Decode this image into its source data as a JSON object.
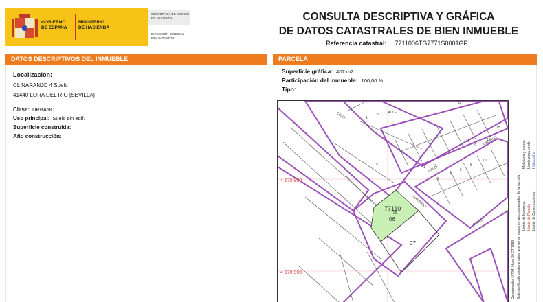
{
  "header": {
    "gov_line1": "GOBIERNO",
    "gov_line2": "DE ESPAÑA",
    "ministry_line1": "MINISTERIO",
    "ministry_line2": "DE HACIENDA",
    "secretaria_line1": "SECRETARÍA DE ESTADO",
    "secretaria_line2": "DE HACIENDA",
    "direccion_line1": "DIRECCIÓN GENERAL",
    "direccion_line2": "DEL CATASTRO",
    "title_line1": "CONSULTA DESCRIPTIVA Y GRÁFICA",
    "title_line2": "DE DATOS CATASTRALES DE BIEN INMUEBLE",
    "ref_label": "Referencia catastral:",
    "ref_value": "7711006TG7771S0001GP"
  },
  "colors": {
    "accent": "#ee7c1e",
    "logo_yellow": "#f7c316",
    "parcel_green": "#c8f0b4",
    "block_purple": "#9b4fb8",
    "coord_red": "#e05050"
  },
  "left": {
    "section_title_prefix": "DATOS DESCRIPTIVOS DEL ",
    "section_title_emph": "INMUEBLE",
    "loc_label": "Localización:",
    "address_line1": "CL NARANJO 4 Suelo",
    "address_line2": "41440 LORA DEL RIO [SEVILLA]",
    "clase_label": "Clase:",
    "clase_value": "URBANO",
    "uso_label": "Uso principal:",
    "uso_value": "Suelo sin edif.",
    "sup_label": "Superficie construida:",
    "ano_label": "Año construcción:"
  },
  "right": {
    "section_title": "PARCELA",
    "sup_label": "Superficie gráfica:",
    "sup_value": "407 m2",
    "part_label": "Participación del inmueble:",
    "part_value": "100,00 %",
    "tipo_label": "Tipo:"
  },
  "map": {
    "coord_y1": "4 170 950",
    "coord_y2": "4 170 900",
    "block_id": "77110",
    "parcel_selected": "06",
    "parcel_other": "07",
    "parcel_small_label": "06",
    "street_calle_1": "CALLE",
    "street_calle_2": "CALLE",
    "street_calle_3": "CALLE",
    "street_calle_4": "CALLE",
    "street_naranjo": "NARANJO",
    "street_ciruelo": "CIRUELO",
    "num_1": "1",
    "num_3": "3",
    "num_4": "4",
    "num_6": "6",
    "num_8": "8",
    "num_10": "10",
    "num_11": "11",
    "num_12": "12",
    "num_15": "15",
    "num_2": "2",
    "num_5": "5",
    "num_9": "9",
    "num_13": "13"
  },
  "legend": {
    "item1": "Límite de Manzana",
    "item2": "Límite de Parcela",
    "item3": "Límite de Construcciones",
    "item4": "Mobiliario y aceras",
    "item5": "Límite zona verde",
    "item6": "Hidrografía",
    "note1": "Este certificado contiene datos que no se ajustan a las coordenadas de la parcela",
    "note2": "Coordenadas U.T.M. Huso 30 ETRS89"
  }
}
